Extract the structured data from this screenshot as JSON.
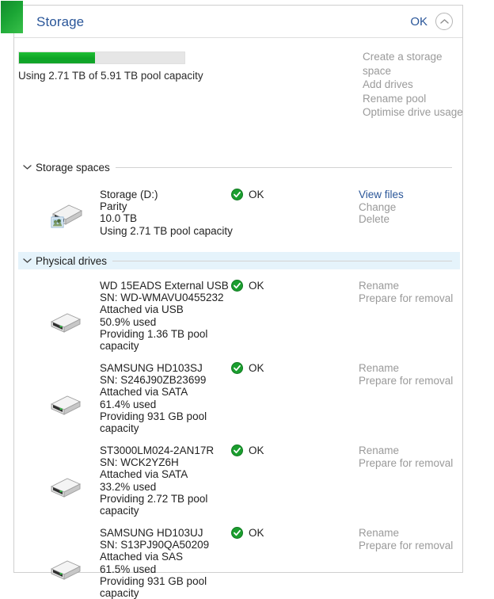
{
  "window": {
    "title": "Storage",
    "ok_label": "OK",
    "collapse_icon": "chevron-up-icon",
    "accent_color": "#1aa534",
    "link_color": "#2a5699",
    "disabled_color": "#9a9a9a",
    "highlight_color": "#e5f3fb"
  },
  "capacity": {
    "used_text": "Using 2.71 TB of 5.91 TB pool capacity",
    "used_tb": 2.71,
    "total_tb": 5.91,
    "percent": 45.9
  },
  "task_links": [
    {
      "label": "Create a storage space",
      "enabled": false
    },
    {
      "label": "Add drives",
      "enabled": false
    },
    {
      "label": "Rename pool",
      "enabled": false
    },
    {
      "label": "Optimise drive usage",
      "enabled": false
    }
  ],
  "sections": [
    {
      "id": "storage-spaces",
      "label": "Storage spaces",
      "expanded": true,
      "highlighted": false,
      "chevron_icon": "chevron-down-icon"
    },
    {
      "id": "physical-drives",
      "label": "Physical drives",
      "expanded": true,
      "highlighted": true,
      "chevron_icon": "chevron-down-icon"
    }
  ],
  "storage_spaces": [
    {
      "name": "Storage (D:)",
      "resiliency": "Parity",
      "size": "10.0 TB",
      "usage": "Using 2.71 TB pool capacity",
      "status": "OK",
      "status_icon": "check-circle-icon",
      "icon": "storage-space-drive-icon",
      "actions": [
        {
          "label": "View files",
          "enabled": true
        },
        {
          "label": "Change",
          "enabled": false
        },
        {
          "label": "Delete",
          "enabled": false
        }
      ]
    }
  ],
  "physical_drives": [
    {
      "name": "WD 15EADS External USB ...",
      "serial": "SN: WD-WMAVU0455232",
      "attached": "Attached via USB",
      "used": "50.9% used",
      "providing": "Providing 1.36 TB pool capacity",
      "status": "OK",
      "status_icon": "check-circle-icon",
      "icon": "physical-drive-icon",
      "actions": [
        {
          "label": "Rename",
          "enabled": false
        },
        {
          "label": "Prepare for removal",
          "enabled": false
        }
      ]
    },
    {
      "name": "SAMSUNG HD103SJ",
      "serial": "SN: S246J90ZB23699",
      "attached": "Attached via SATA",
      "used": "61.4% used",
      "providing": "Providing 931 GB pool capacity",
      "status": "OK",
      "status_icon": "check-circle-icon",
      "icon": "physical-drive-icon",
      "actions": [
        {
          "label": "Rename",
          "enabled": false
        },
        {
          "label": "Prepare for removal",
          "enabled": false
        }
      ]
    },
    {
      "name": "ST3000LM024-2AN17R",
      "serial": "SN: WCK2YZ6H",
      "attached": "Attached via SATA",
      "used": "33.2% used",
      "providing": "Providing 2.72 TB pool capacity",
      "status": "OK",
      "status_icon": "check-circle-icon",
      "icon": "physical-drive-icon",
      "actions": [
        {
          "label": "Rename",
          "enabled": false
        },
        {
          "label": "Prepare for removal",
          "enabled": false
        }
      ]
    },
    {
      "name": "SAMSUNG HD103UJ",
      "serial": "SN: S13PJ90QA50209",
      "attached": "Attached via SAS",
      "used": "61.5% used",
      "providing": "Providing 931 GB pool capacity",
      "status": "OK",
      "status_icon": "check-circle-icon",
      "icon": "physical-drive-icon",
      "actions": [
        {
          "label": "Rename",
          "enabled": false
        },
        {
          "label": "Prepare for removal",
          "enabled": false
        }
      ]
    }
  ]
}
